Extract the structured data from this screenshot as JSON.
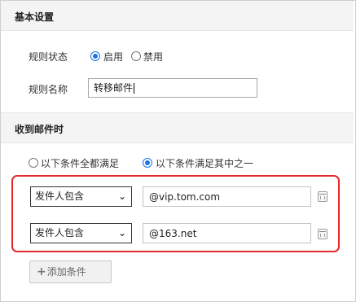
{
  "basic_settings": {
    "title": "基本设置",
    "rule_status_label": "规则状态",
    "enable_label": "启用",
    "disable_label": "禁用",
    "rule_name_label": "规则名称",
    "rule_name_value": "转移邮件"
  },
  "on_receive": {
    "title": "收到邮件时",
    "match_all_label": "以下条件全都满足",
    "match_any_label": "以下条件满足其中之一",
    "selected_match": "match_any",
    "conditions": [
      {
        "field": "发件人包含",
        "value": "@vip.tom.com"
      },
      {
        "field": "发件人包含",
        "value": "@163.net"
      }
    ],
    "add_condition_label": "添加条件"
  },
  "colors": {
    "highlight_border": "#e5282c",
    "radio_accent": "#1a73e8"
  },
  "icons": {
    "dropdown": "chevron-down-icon",
    "delete": "trash-icon",
    "add": "plus-icon"
  }
}
